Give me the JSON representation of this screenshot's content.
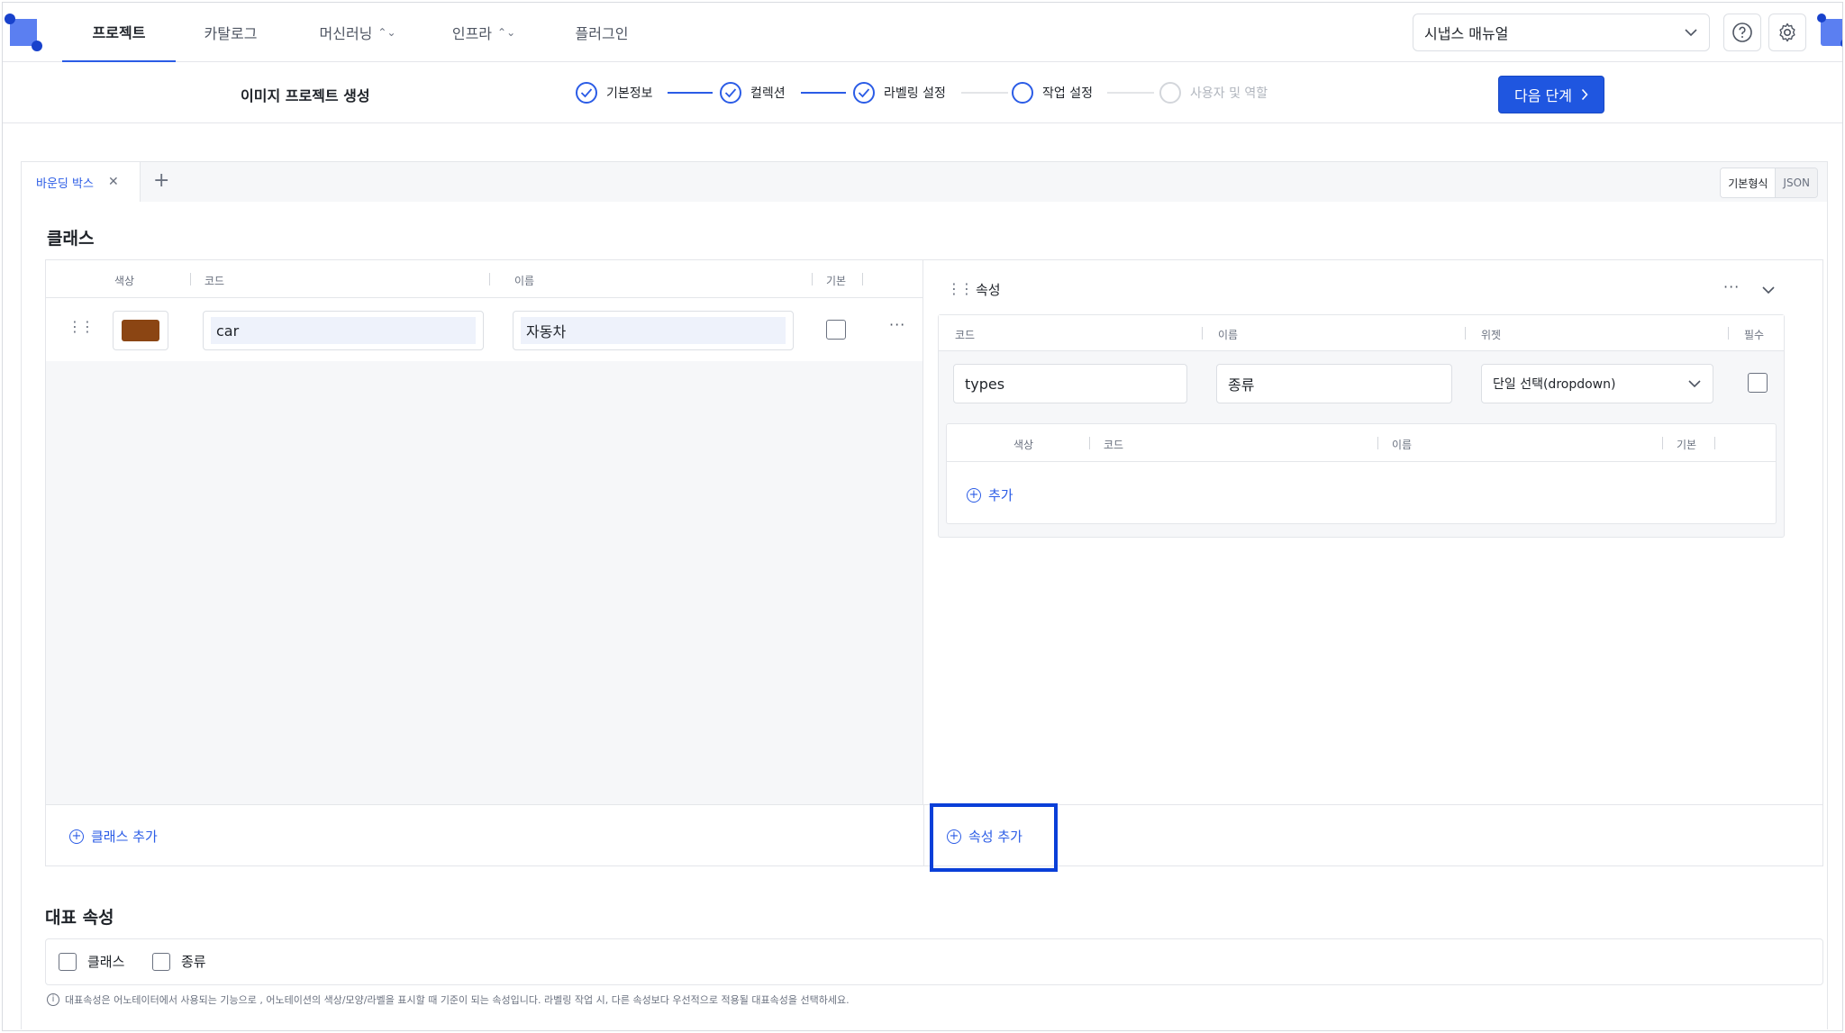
{
  "nav": {
    "tabs": [
      {
        "label": "프로젝트",
        "active": true
      },
      {
        "label": "카탈로그",
        "active": false
      },
      {
        "label": "머신러닝",
        "active": false
      },
      {
        "label": "인프라",
        "active": false
      },
      {
        "label": "플러그인",
        "active": false
      }
    ],
    "manual_select": "시냅스 매뉴얼",
    "help_icon": "help-circle-icon",
    "settings_icon": "gear-icon"
  },
  "header": {
    "page_title": "이미지 프로젝트 생성",
    "steps": [
      {
        "label": "기본정보",
        "state": "done"
      },
      {
        "label": "컬렉션",
        "state": "done"
      },
      {
        "label": "라벨링 설정",
        "state": "done"
      },
      {
        "label": "작업 설정",
        "state": "current"
      },
      {
        "label": "사용자 및 역할",
        "state": "disabled"
      }
    ],
    "next_button": "다음 단계"
  },
  "tabs": {
    "items": [
      {
        "label": "바운딩 박스"
      }
    ],
    "add": "+",
    "format_basic": "기본형식",
    "format_json": "JSON"
  },
  "classes": {
    "title": "클래스",
    "columns": {
      "color": "색상",
      "code": "코드",
      "name": "이름",
      "default": "기본"
    },
    "rows": [
      {
        "color": "#8b4513",
        "code": "car",
        "name": "자동차",
        "default": false
      }
    ],
    "add_label": "클래스 추가"
  },
  "attributes": {
    "title": "속성",
    "columns": {
      "code": "코드",
      "name": "이름",
      "widget": "위젯",
      "required": "필수"
    },
    "rows": [
      {
        "code": "types",
        "name": "종류",
        "widget": "단일 선택(dropdown)",
        "required": false
      }
    ],
    "option_columns": {
      "color": "색상",
      "code": "코드",
      "name": "이름",
      "default": "기본"
    },
    "option_add": "추가",
    "add_label": "속성 추가"
  },
  "representative": {
    "title": "대표 속성",
    "items": [
      {
        "label": "클래스"
      },
      {
        "label": "종류"
      }
    ],
    "hint": "대표속성은 어노테이터에서 사용되는 기능으로 , 어노테이션의 색상/모양/라벨을 표시할 때 기준이 되는 속성입니다. 라벨링 작업 시, 다른 속성보다 우선적으로 적용될 대표속성을 선택하세요."
  },
  "colors": {
    "accent": "#2b5ce6",
    "primary_button": "#1f56e0",
    "highlight": "#0a3fd8"
  }
}
